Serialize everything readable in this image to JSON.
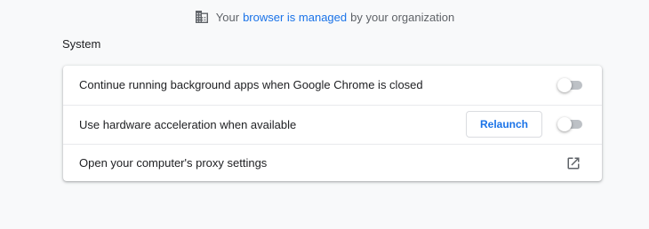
{
  "banner": {
    "prefix": "Your",
    "link": "browser is managed",
    "suffix": "by your organization",
    "icon": "building-icon"
  },
  "section": {
    "title": "System"
  },
  "settings": {
    "rows": [
      {
        "label": "Continue running background apps when Google Chrome is closed",
        "control": "toggle",
        "checked": false
      },
      {
        "label": "Use hardware acceleration when available",
        "button_label": "Relaunch",
        "control": "toggle",
        "checked": false
      },
      {
        "label": "Open your computer's proxy settings",
        "control": "external-link",
        "icon": "open-in-new-icon"
      }
    ]
  },
  "colors": {
    "accent": "#1a73e8",
    "background": "#f8f9fa",
    "card": "#ffffff",
    "toggle_off_track": "#bdc1c6"
  }
}
